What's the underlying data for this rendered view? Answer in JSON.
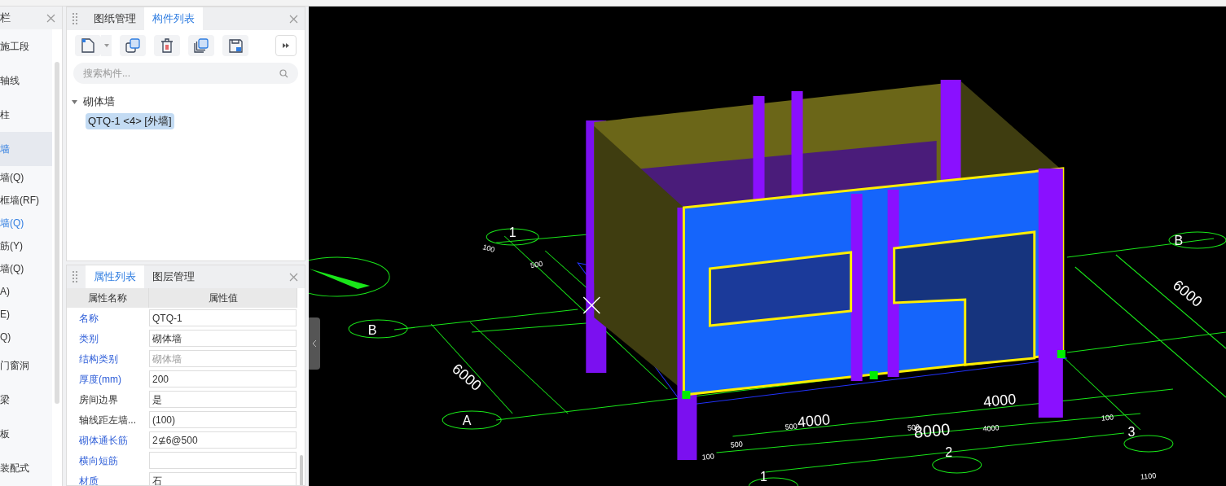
{
  "nav": {
    "title": "栏",
    "items": [
      {
        "label": "施工段",
        "kind": "category",
        "selected": false
      },
      {
        "label": "轴线",
        "kind": "category",
        "selected": false
      },
      {
        "label": "柱",
        "kind": "category",
        "selected": false
      },
      {
        "label": "墙",
        "kind": "category",
        "selected": true
      },
      {
        "label": "墙(Q)",
        "kind": "item",
        "selected": false
      },
      {
        "label": "框墙(RF)",
        "kind": "item",
        "selected": false
      },
      {
        "label": "墙(Q)",
        "kind": "item",
        "selected": true
      },
      {
        "label": "筋(Y)",
        "kind": "item",
        "selected": false
      },
      {
        "label": "墙(Q)",
        "kind": "item",
        "selected": false
      },
      {
        "label": "A)",
        "kind": "item",
        "selected": false
      },
      {
        "label": "E)",
        "kind": "item",
        "selected": false
      },
      {
        "label": "Q)",
        "kind": "item",
        "selected": false
      },
      {
        "label": "门窗洞",
        "kind": "category",
        "selected": false
      },
      {
        "label": "梁",
        "kind": "category",
        "selected": false
      },
      {
        "label": "板",
        "kind": "category",
        "selected": false
      },
      {
        "label": "装配式",
        "kind": "category",
        "selected": false
      }
    ]
  },
  "component_panel": {
    "tabs": [
      {
        "label": "图纸管理",
        "selected": false
      },
      {
        "label": "构件列表",
        "selected": true
      }
    ],
    "toolbar": [
      {
        "kind": "new"
      },
      {
        "kind": "copy"
      },
      {
        "kind": "delete"
      },
      {
        "kind": "layers"
      },
      {
        "kind": "save"
      }
    ],
    "search": {
      "placeholder": "搜索构件..."
    },
    "tree": [
      {
        "label": "砌体墙",
        "expanded": true,
        "selected": false,
        "children": [
          {
            "label": "QTQ-1 <4> [外墙]",
            "selected": true
          }
        ]
      }
    ]
  },
  "property_panel": {
    "tabs": [
      {
        "label": "属性列表",
        "selected": true
      },
      {
        "label": "图层管理",
        "selected": false
      }
    ],
    "columns": [
      "属性名称",
      "属性值"
    ],
    "rows": [
      {
        "name": "名称",
        "value": "QTQ-1",
        "public": true,
        "disabled": false
      },
      {
        "name": "类别",
        "value": "砌体墙",
        "public": true,
        "disabled": false
      },
      {
        "name": "结构类别",
        "value": "砌体墙",
        "public": true,
        "disabled": true
      },
      {
        "name": "厚度(mm)",
        "value": "200",
        "public": true,
        "disabled": false
      },
      {
        "name": "房间边界",
        "value": "是",
        "public": false,
        "disabled": false
      },
      {
        "name": "轴线距左墙...",
        "value": "(100)",
        "public": false,
        "disabled": false
      },
      {
        "name": "砌体通长筋",
        "value": "2⊈6@500",
        "public": true,
        "disabled": false
      },
      {
        "name": "横向短筋",
        "value": "",
        "public": true,
        "disabled": false
      },
      {
        "name": "材质",
        "value": "石",
        "public": true,
        "disabled": false
      }
    ]
  },
  "viewport": {
    "labels": [
      "1",
      "B",
      "A",
      "6000",
      "4000",
      "8000",
      "4000",
      "2",
      "3",
      "B",
      "6000",
      "1",
      "100",
      "500",
      "100",
      "500",
      "500",
      "500",
      "4000",
      "100",
      "1100"
    ]
  }
}
